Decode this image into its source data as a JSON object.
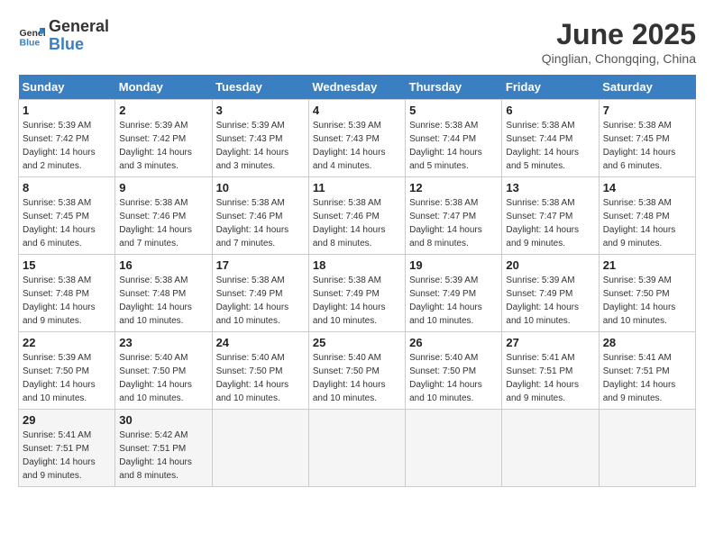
{
  "header": {
    "logo_general": "General",
    "logo_blue": "Blue",
    "month_title": "June 2025",
    "subtitle": "Qinglian, Chongqing, China"
  },
  "weekdays": [
    "Sunday",
    "Monday",
    "Tuesday",
    "Wednesday",
    "Thursday",
    "Friday",
    "Saturday"
  ],
  "weeks": [
    [
      {
        "day": "1",
        "sunrise": "5:39 AM",
        "sunset": "7:42 PM",
        "daylight": "14 hours and 2 minutes."
      },
      {
        "day": "2",
        "sunrise": "5:39 AM",
        "sunset": "7:42 PM",
        "daylight": "14 hours and 3 minutes."
      },
      {
        "day": "3",
        "sunrise": "5:39 AM",
        "sunset": "7:43 PM",
        "daylight": "14 hours and 3 minutes."
      },
      {
        "day": "4",
        "sunrise": "5:39 AM",
        "sunset": "7:43 PM",
        "daylight": "14 hours and 4 minutes."
      },
      {
        "day": "5",
        "sunrise": "5:38 AM",
        "sunset": "7:44 PM",
        "daylight": "14 hours and 5 minutes."
      },
      {
        "day": "6",
        "sunrise": "5:38 AM",
        "sunset": "7:44 PM",
        "daylight": "14 hours and 5 minutes."
      },
      {
        "day": "7",
        "sunrise": "5:38 AM",
        "sunset": "7:45 PM",
        "daylight": "14 hours and 6 minutes."
      }
    ],
    [
      {
        "day": "8",
        "sunrise": "5:38 AM",
        "sunset": "7:45 PM",
        "daylight": "14 hours and 6 minutes."
      },
      {
        "day": "9",
        "sunrise": "5:38 AM",
        "sunset": "7:46 PM",
        "daylight": "14 hours and 7 minutes."
      },
      {
        "day": "10",
        "sunrise": "5:38 AM",
        "sunset": "7:46 PM",
        "daylight": "14 hours and 7 minutes."
      },
      {
        "day": "11",
        "sunrise": "5:38 AM",
        "sunset": "7:46 PM",
        "daylight": "14 hours and 8 minutes."
      },
      {
        "day": "12",
        "sunrise": "5:38 AM",
        "sunset": "7:47 PM",
        "daylight": "14 hours and 8 minutes."
      },
      {
        "day": "13",
        "sunrise": "5:38 AM",
        "sunset": "7:47 PM",
        "daylight": "14 hours and 9 minutes."
      },
      {
        "day": "14",
        "sunrise": "5:38 AM",
        "sunset": "7:48 PM",
        "daylight": "14 hours and 9 minutes."
      }
    ],
    [
      {
        "day": "15",
        "sunrise": "5:38 AM",
        "sunset": "7:48 PM",
        "daylight": "14 hours and 9 minutes."
      },
      {
        "day": "16",
        "sunrise": "5:38 AM",
        "sunset": "7:48 PM",
        "daylight": "14 hours and 10 minutes."
      },
      {
        "day": "17",
        "sunrise": "5:38 AM",
        "sunset": "7:49 PM",
        "daylight": "14 hours and 10 minutes."
      },
      {
        "day": "18",
        "sunrise": "5:38 AM",
        "sunset": "7:49 PM",
        "daylight": "14 hours and 10 minutes."
      },
      {
        "day": "19",
        "sunrise": "5:39 AM",
        "sunset": "7:49 PM",
        "daylight": "14 hours and 10 minutes."
      },
      {
        "day": "20",
        "sunrise": "5:39 AM",
        "sunset": "7:49 PM",
        "daylight": "14 hours and 10 minutes."
      },
      {
        "day": "21",
        "sunrise": "5:39 AM",
        "sunset": "7:50 PM",
        "daylight": "14 hours and 10 minutes."
      }
    ],
    [
      {
        "day": "22",
        "sunrise": "5:39 AM",
        "sunset": "7:50 PM",
        "daylight": "14 hours and 10 minutes."
      },
      {
        "day": "23",
        "sunrise": "5:40 AM",
        "sunset": "7:50 PM",
        "daylight": "14 hours and 10 minutes."
      },
      {
        "day": "24",
        "sunrise": "5:40 AM",
        "sunset": "7:50 PM",
        "daylight": "14 hours and 10 minutes."
      },
      {
        "day": "25",
        "sunrise": "5:40 AM",
        "sunset": "7:50 PM",
        "daylight": "14 hours and 10 minutes."
      },
      {
        "day": "26",
        "sunrise": "5:40 AM",
        "sunset": "7:50 PM",
        "daylight": "14 hours and 10 minutes."
      },
      {
        "day": "27",
        "sunrise": "5:41 AM",
        "sunset": "7:51 PM",
        "daylight": "14 hours and 9 minutes."
      },
      {
        "day": "28",
        "sunrise": "5:41 AM",
        "sunset": "7:51 PM",
        "daylight": "14 hours and 9 minutes."
      }
    ],
    [
      {
        "day": "29",
        "sunrise": "5:41 AM",
        "sunset": "7:51 PM",
        "daylight": "14 hours and 9 minutes."
      },
      {
        "day": "30",
        "sunrise": "5:42 AM",
        "sunset": "7:51 PM",
        "daylight": "14 hours and 8 minutes."
      },
      null,
      null,
      null,
      null,
      null
    ]
  ],
  "labels": {
    "sunrise_prefix": "Sunrise: ",
    "sunset_prefix": "Sunset: ",
    "daylight_prefix": "Daylight: "
  }
}
